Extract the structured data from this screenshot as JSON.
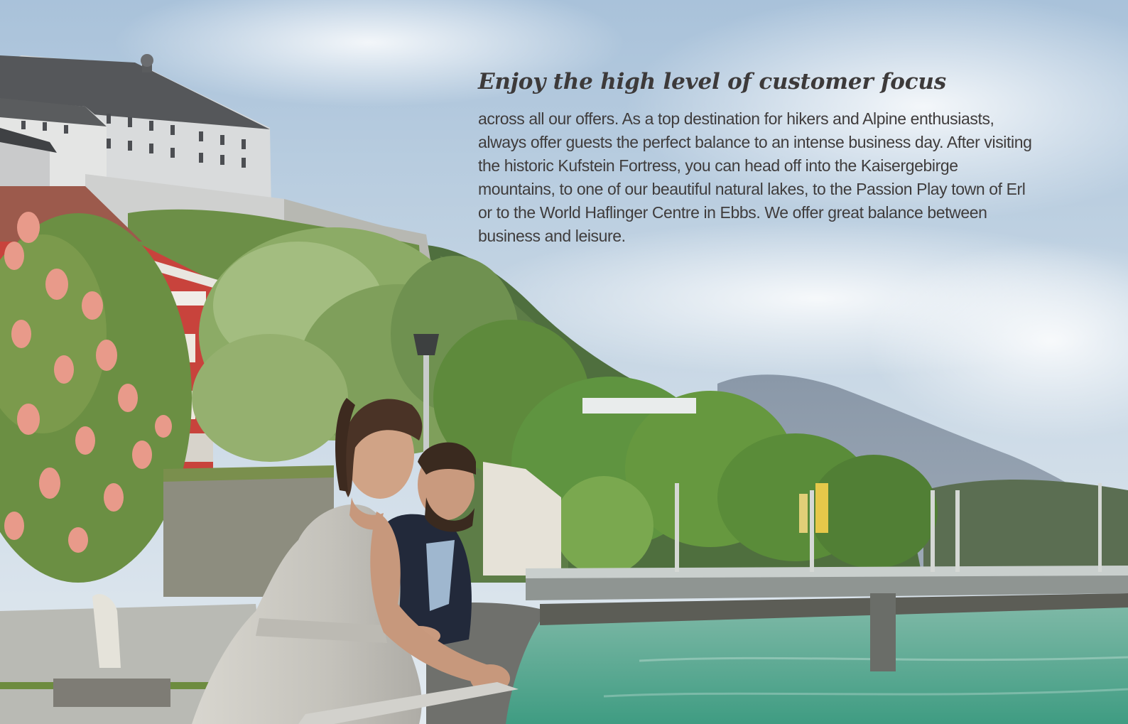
{
  "article": {
    "headline": "Enjoy the high level of customer focus",
    "body": "across all our offers. As a top destination for hikers and Alpine enthusiasts, always offer guests the perfect balance to an intense business day. After visiting the historic Kufstein Fortress, you can head off into the Kaisergebirge mountains, to one of our beautiful natural lakes, to the Passion Play town of Erl or to the World Haflinger Centre in Ebbs. We offer great balance between business and leisure."
  },
  "colors": {
    "headline": "#3d3a3a",
    "body_text": "#3f3c3c",
    "sky": "#b9cde0",
    "river": "#5fae94",
    "foliage": "#5f8f3a",
    "blossom": "#e79b8e"
  }
}
